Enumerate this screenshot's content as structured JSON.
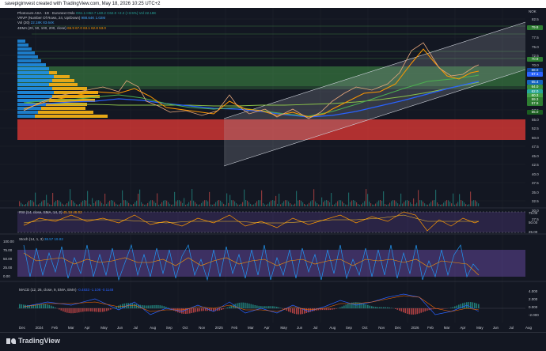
{
  "header": {
    "credit": "savepigimvest created with TradingView.com, May 18, 2026 10:25 UTC+2"
  },
  "legend": {
    "line1": "Photocure ASA · 1D · Euronext Oslo",
    "line1_values": "O61.1 H62.7 L60.2 C62.0 +2.2 (+3.5%) Vol 22.18K",
    "line2": "VRVP (Number Of Rows, 24, Up/Down)",
    "line2_values": "988.64K 1.02M",
    "line3": "Vol (20)",
    "line3_values": "22.18K 83.64K",
    "line4": "4EMA (20, 50, 100, 200, close)",
    "line4_values": "65.9 67.0 63.1 62.8 53.0"
  },
  "price_axis": {
    "label": "NOK",
    "ticks": [
      "82.5",
      "80.0",
      "77.5",
      "75.0",
      "72.5",
      "70.0",
      "67.5",
      "65.0",
      "62.5",
      "60.0",
      "57.5",
      "55.0",
      "52.5",
      "50.0",
      "47.5",
      "45.0",
      "42.5",
      "40.0",
      "37.5",
      "35.0",
      "32.5",
      "30.0",
      "27.5"
    ],
    "tags": [
      {
        "text": "79.8",
        "color": "#2e7d32"
      },
      {
        "text": "70.9",
        "color": "#2e7d32"
      },
      {
        "text": "68.0",
        "color": "#0d47a1"
      },
      {
        "text": "67.1",
        "color": "#2962ff"
      },
      {
        "text": "65.4",
        "color": "#1565c0"
      },
      {
        "text": "64.0",
        "color": "#388e3c"
      },
      {
        "text": "62.0",
        "color": "#26a69a"
      },
      {
        "text": "60.3",
        "color": "#43a047"
      },
      {
        "text": "59.3",
        "color": "#2e7d32"
      },
      {
        "text": "57.9",
        "color": "#2e7d32"
      },
      {
        "text": "55.0",
        "color": "#1b5e20"
      }
    ]
  },
  "rsi": {
    "title": "RSI (14, close, SMA, 14, 2)",
    "values": "45.19 48.02",
    "ticks": [
      "75.00",
      "50.00",
      "25.00"
    ]
  },
  "stoch": {
    "title": "Stoch (14, 1, 3)",
    "values": "38.57 19.82",
    "ticks": [
      "100.00",
      "75.00",
      "50.00",
      "25.00",
      "0.00"
    ]
  },
  "macd": {
    "title": "MACD (12, 26, close, 9, EMA, EMA)",
    "values": "-0.4833 -1.108 -0.1148",
    "ticks": [
      "4.000",
      "2.000",
      "0.000",
      "-2.000"
    ]
  },
  "time_axis": [
    "Dec",
    "2024",
    "Feb",
    "Mar",
    "Apr",
    "May",
    "Jun",
    "Jul",
    "Aug",
    "Sep",
    "Oct",
    "Nov",
    "2025",
    "Feb",
    "Mar",
    "Apr",
    "May",
    "Jun",
    "Jul",
    "Aug",
    "Sep",
    "Oct",
    "Nov",
    "Dec",
    "2026",
    "Feb",
    "Mar",
    "Apr",
    "May",
    "Jun",
    "Jul",
    "Aug"
  ],
  "brand": "TradingView",
  "colors": {
    "background": "#131722",
    "green_zone": "#4caf50",
    "red_zone": "#e53935",
    "ema20": "#ff9800",
    "ema50": "#4caf50",
    "ema100": "#2962ff",
    "ema200": "#8bc34a",
    "rsi_band": "#7e57c2"
  }
}
